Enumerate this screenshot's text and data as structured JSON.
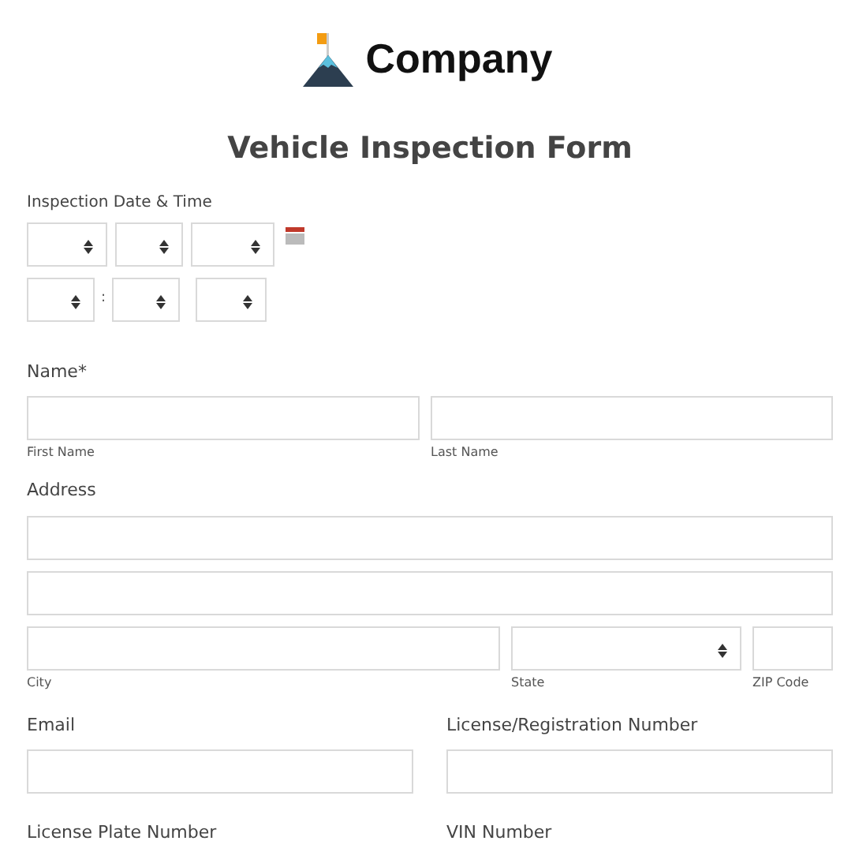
{
  "logo": {
    "name": "Company"
  },
  "title": "Vehicle Inspection Form",
  "datetime": {
    "label": "Inspection Date & Time",
    "separator": ":"
  },
  "name": {
    "label": "Name*",
    "sublabels": [
      "First Name",
      "Last Name"
    ]
  },
  "address": {
    "label": "Address",
    "sublabels": [
      "City",
      "State",
      "ZIP Code"
    ]
  },
  "row_contact": [
    {
      "label": "Email"
    },
    {
      "label": "License/Registration Number"
    }
  ],
  "row_vehicle": [
    {
      "label": "License Plate Number"
    },
    {
      "label": "VIN Number"
    }
  ]
}
